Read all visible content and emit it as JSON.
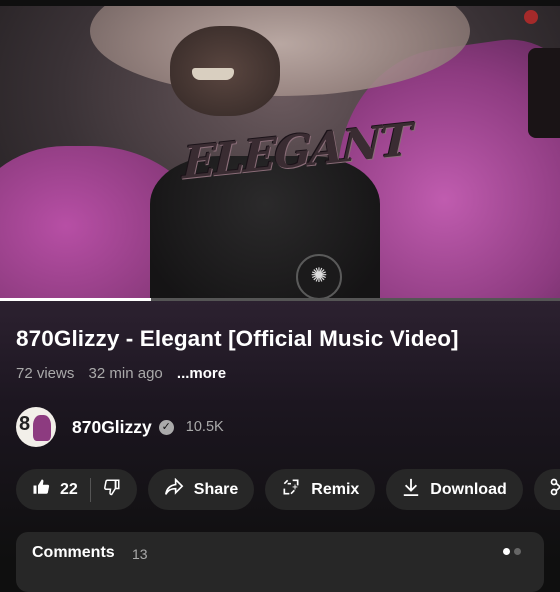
{
  "video": {
    "overlay_logo": "ELEGANT",
    "progress_fraction": 0.27
  },
  "title": "870Glizzy - Elegant [Official Music Video]",
  "meta": {
    "views": "72 views",
    "age": "32 min ago",
    "more": "...more"
  },
  "channel": {
    "name": "870Glizzy",
    "avatar_text": "8",
    "verified_icon": "verified-check-icon",
    "subscribers": "10.5K"
  },
  "actions": {
    "likes": "22",
    "share": "Share",
    "remix": "Remix",
    "download": "Download"
  },
  "comments": {
    "label": "Comments",
    "count": "13"
  }
}
